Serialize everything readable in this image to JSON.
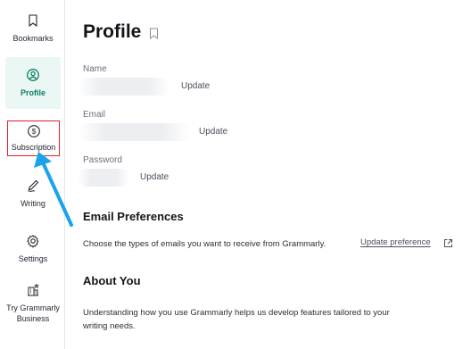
{
  "sidebar": {
    "items": [
      {
        "label": "Bookmarks",
        "icon": "bookmark-icon"
      },
      {
        "label": "Profile",
        "icon": "user-circle-icon"
      },
      {
        "label": "Subscription",
        "icon": "dollar-circle-icon"
      },
      {
        "label": "Writing",
        "icon": "pen-icon"
      },
      {
        "label": "Settings",
        "icon": "gear-icon"
      },
      {
        "label_line1": "Try Grammarly",
        "label_line2": "Business",
        "icon": "building-star-icon"
      }
    ]
  },
  "page": {
    "title": "Profile",
    "fields": [
      {
        "label": "Name",
        "update_label": "Update"
      },
      {
        "label": "Email",
        "update_label": "Update"
      },
      {
        "label": "Password",
        "update_label": "Update"
      }
    ],
    "email_preferences": {
      "heading": "Email Preferences",
      "description": "Choose the types of emails you want to receive from Grammarly.",
      "link_label": "Update preference"
    },
    "about_you": {
      "heading": "About You",
      "description_line1": "Understanding how you use Grammarly helps us develop features tailored to your",
      "description_line2": "writing needs."
    }
  },
  "colors": {
    "accent": "#0f7c66",
    "active_bg": "#eaf7f4",
    "highlight_box": "#e1202d",
    "annotation_arrow": "#1aa3ec"
  }
}
